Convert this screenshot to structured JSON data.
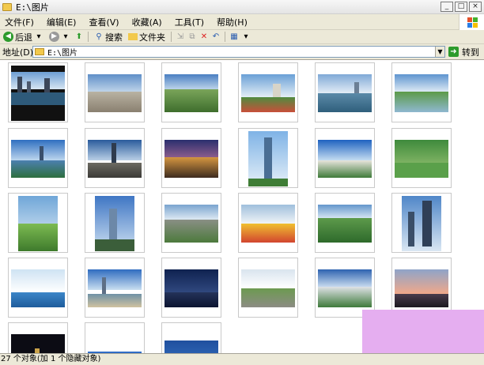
{
  "window": {
    "title": "E:\\图片"
  },
  "menu": [
    "文件(F)",
    "编辑(E)",
    "查看(V)",
    "收藏(A)",
    "工具(T)",
    "帮助(H)"
  ],
  "toolbar": {
    "back": "后退",
    "search": "搜索",
    "folders": "文件夹"
  },
  "address": {
    "label": "地址(D)",
    "path": "E:\\图片",
    "go": "转到"
  },
  "status": {
    "text": "27 个对象(加 1 个隐藏对象)"
  },
  "colors": {
    "pink_overlay": "#e5aef0",
    "folder": "#f2c94c"
  }
}
